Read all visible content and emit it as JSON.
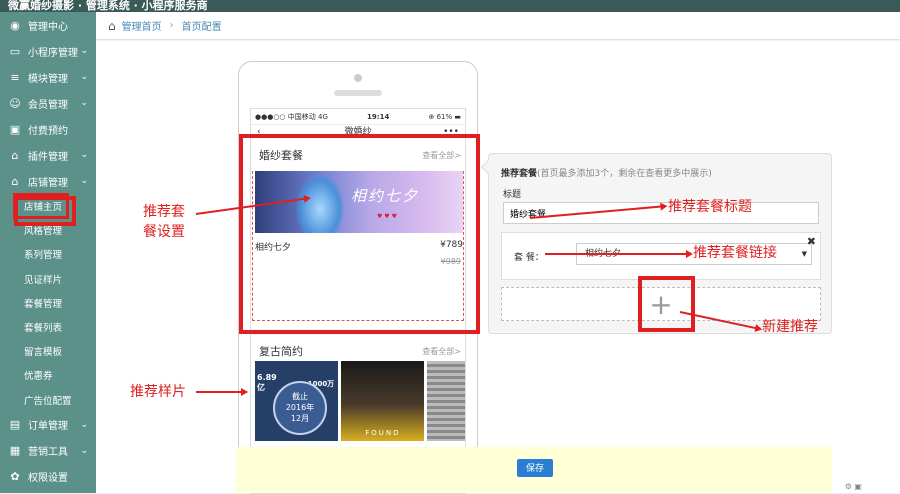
{
  "window": {
    "title": "微赢婚纱摄影 · 管理系统 · 小程序服务商"
  },
  "breadcrumb": {
    "home": "管理首页",
    "current": "首页配置"
  },
  "sidebar": {
    "items": [
      {
        "icon": "dashboard-icon",
        "glyph": "◉",
        "label": "管理中心",
        "chevron": false
      },
      {
        "icon": "monitor-icon",
        "glyph": "▭",
        "label": "小程序管理",
        "chevron": true
      },
      {
        "icon": "list-icon",
        "glyph": "≡",
        "label": "模块管理",
        "chevron": true
      },
      {
        "icon": "user-icon",
        "glyph": "☺",
        "label": "会员管理",
        "chevron": true
      },
      {
        "icon": "card-icon",
        "glyph": "▣",
        "label": "付费预约",
        "chevron": false
      },
      {
        "icon": "home-icon",
        "glyph": "⌂",
        "label": "插件管理",
        "chevron": true
      },
      {
        "icon": "store-icon",
        "glyph": "⌂",
        "label": "店铺管理",
        "chevron": true
      }
    ],
    "subitems": [
      "店铺主页",
      "风格管理",
      "系列管理",
      "见证样片",
      "套餐管理",
      "套餐列表",
      "留言模板",
      "优惠券",
      "广告位配置"
    ],
    "bottom": [
      {
        "icon": "order-icon",
        "glyph": "▤",
        "label": "订单管理",
        "chevron": true
      },
      {
        "icon": "briefcase-icon",
        "glyph": "▦",
        "label": "营销工具",
        "chevron": true
      },
      {
        "icon": "gear-icon",
        "glyph": "✿",
        "label": "权限设置",
        "chevron": false
      }
    ]
  },
  "phone": {
    "status": {
      "carrier": "●●●○○ 中国移动  4G",
      "time": "19:14",
      "battery": "⊕  61% ▬"
    },
    "nav_title": "微婚纱",
    "card1": {
      "title": "婚纱套餐",
      "more": "查看全部>",
      "banner_logo": "相约七夕",
      "banner_hearts": "♥ ♥ ♥",
      "pkg_name": "相约七夕",
      "price": "¥789",
      "old_price": "¥989"
    },
    "card2": {
      "title": "复古简约",
      "more": "查看全部>",
      "sample1_line1": "6.89",
      "sample1_line2": "亿",
      "sample1_badge": "截止\n2016年\n12月",
      "sample1_top": "1000万",
      "sample2_text": "FOUND"
    }
  },
  "panel": {
    "heading_bold": "推荐套餐",
    "heading_hint": "(首页最多添加3个，剩余在查看更多中展示)",
    "title_label": "标题",
    "title_value": "婚纱套餐",
    "link_label": "套  餐：",
    "link_value": "相约七夕",
    "add_symbol": "+"
  },
  "save_button": "保存",
  "annotations": {
    "recommend_setting": "推荐套\n餐设置",
    "recommend_sample": "推荐样片",
    "package_title": "推荐套餐标题",
    "package_link": "推荐套餐链接",
    "new_recommend": "新建推荐"
  },
  "colors": {
    "sidebar": "#5c918a",
    "annotation": "#e02020",
    "save": "#2a7fd4",
    "savebar": "#ffffd8"
  }
}
